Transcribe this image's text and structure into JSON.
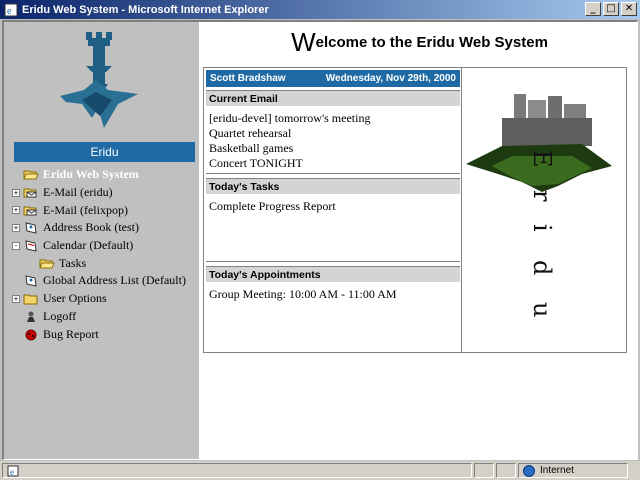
{
  "window": {
    "title": "Eridu Web System - Microsoft Internet Explorer",
    "controls": [
      "_",
      "□",
      "✕"
    ]
  },
  "sidebar": {
    "header": "Eridu",
    "tree": [
      {
        "label": "Eridu Web System",
        "icon": "folder-open-icon",
        "root": true
      },
      {
        "label": "E-Mail (eridu)",
        "icon": "mail-folder-icon",
        "expander": "+"
      },
      {
        "label": "E-Mail (felixpop)",
        "icon": "mail-folder-icon",
        "expander": "+"
      },
      {
        "label": "Address Book (test)",
        "icon": "address-book-icon",
        "expander": "+"
      },
      {
        "label": "Calendar (Default)",
        "icon": "calendar-icon",
        "expander": "-"
      },
      {
        "label": "Tasks",
        "icon": "tasks-folder-icon",
        "indent": true
      },
      {
        "label": "Global Address List (Default)",
        "icon": "address-book-icon"
      },
      {
        "label": "User Options",
        "icon": "folder-icon",
        "expander": "+"
      },
      {
        "label": "Logoff",
        "icon": "logoff-icon"
      },
      {
        "label": "Bug Report",
        "icon": "bug-icon"
      }
    ]
  },
  "main": {
    "welcome_first": "W",
    "welcome_rest": "elcome to the Eridu Web System",
    "user": "Scott Bradshaw",
    "date": "Wednesday, Nov 29th, 2000",
    "current_email": {
      "heading": "Current Email",
      "items": [
        "[eridu-devel] tomorrow's meeting",
        "Quartet rehearsal",
        "Basketball games",
        "Concert TONIGHT"
      ]
    },
    "tasks": {
      "heading": "Today's Tasks",
      "items": [
        "Complete Progress Report"
      ]
    },
    "appointments": {
      "heading": "Today's Appointments",
      "items": [
        "Group Meeting: 10:00 AM - 11:00 AM"
      ]
    },
    "art_letters": [
      "E",
      "r",
      "i",
      "d",
      "u"
    ]
  },
  "statusbar": {
    "zone": "Internet"
  },
  "colors": {
    "accent": "#1f6aa5",
    "titlebar": "#0a246a",
    "sidebar_bg": "#c0c0c0"
  }
}
